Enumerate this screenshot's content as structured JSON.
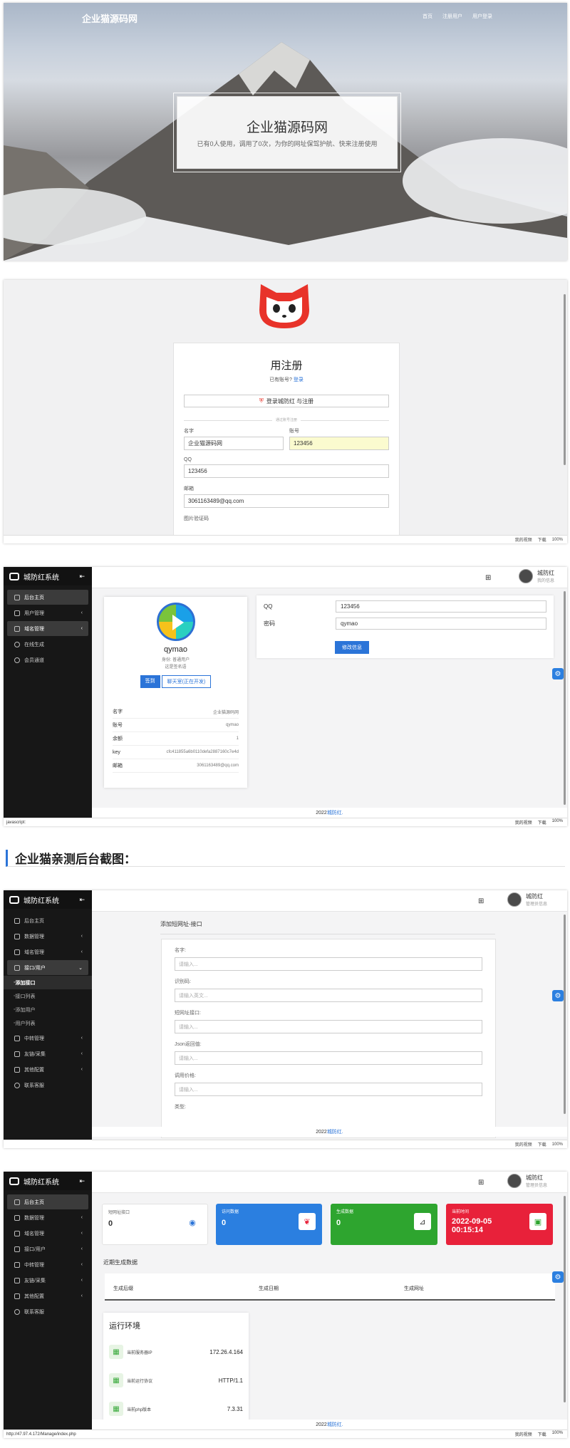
{
  "hero": {
    "title": "企业猫源码网",
    "nav": [
      "首页",
      "注册用户",
      "用户登录"
    ],
    "heading": "企业猫源码网",
    "subtitle": "已有0人使用，调用了0次，为你的网址保驾护航、快来注册使用"
  },
  "register": {
    "heading": "用注册",
    "have_account": "已有账号?",
    "login_link": "登录",
    "qq_button": "登录城防红 与注册",
    "divider": "通过账号注册",
    "fields": {
      "name_label": "名字",
      "name_value": "企业猫源码网",
      "account_label": "账号",
      "account_value": "123456",
      "qq_label": "QQ",
      "qq_value": "123456",
      "email_label": "邮箱",
      "email_value": "3061163489@qq.com",
      "captcha_label": "图片验证码"
    }
  },
  "statusbar": {
    "items": [
      "我的视频",
      "下载",
      "100%"
    ],
    "js": "javascript:",
    "url": "http://47.97.4.172/Manage/index.php"
  },
  "admin1": {
    "brand": "城防红系统",
    "menu": [
      "后台主页",
      "用户管理",
      "域名管理",
      "在线生成",
      "会员通道"
    ],
    "user": {
      "name": "城防红",
      "role": "我的信息"
    },
    "profile": {
      "name": "qymao",
      "role": "身份: 普通用户",
      "note": "这是签名语",
      "btn_sign": "签到",
      "btn_chat": "聊天室(正在开发)",
      "table": [
        {
          "k": "名字",
          "v": "企业猫源码网"
        },
        {
          "k": "账号",
          "v": "qymao"
        },
        {
          "k": "余额",
          "v": "1"
        },
        {
          "k": "key",
          "v": "cfc411855a6b0110defa2887160c7e4d"
        },
        {
          "k": "邮箱",
          "v": "3061163489@qq.com"
        }
      ]
    },
    "form": {
      "qq_label": "QQ",
      "qq_value": "123456",
      "pw_label": "密码",
      "pw_value": "qymao",
      "save": "修改信息"
    },
    "footer_year": "2022 ",
    "footer_link": "城防红."
  },
  "section_heading": "企业猫亲测后台截图：",
  "admin2": {
    "brand": "城防红系统",
    "menu": [
      "后台主页",
      "数据管理",
      "域名管理",
      "接口/用户",
      "中转管理",
      "友链/采集",
      "其他配置",
      "联系客服"
    ],
    "submenu": [
      "添加接口",
      "接口列表",
      "添加用户",
      "用户列表"
    ],
    "user": {
      "name": "城防红",
      "role": "管理员信息"
    },
    "form_title": "添加短网址-接口",
    "fields": [
      {
        "label": "名字:",
        "placeholder": "请输入..."
      },
      {
        "label": "识别码:",
        "placeholder": "请输入英文..."
      },
      {
        "label": "短网址接口:",
        "placeholder": "请输入..."
      },
      {
        "label": "Json返回值:",
        "placeholder": "请输入..."
      },
      {
        "label": "调用价格:",
        "placeholder": "请输入..."
      },
      {
        "label": "类型:",
        "placeholder": ""
      }
    ],
    "footer_year": "2022 ",
    "footer_link": "城防红."
  },
  "admin3": {
    "brand": "城防红系统",
    "menu": [
      "后台主页",
      "数据管理",
      "域名管理",
      "接口/用户",
      "中转管理",
      "友链/采集",
      "其他配置",
      "联系客服"
    ],
    "user": {
      "name": "城防红",
      "role": "管理员信息"
    },
    "stats": [
      {
        "label": "短网址接口",
        "value": "0",
        "color": "#ffffff"
      },
      {
        "label": "访问数据",
        "value": "0",
        "color": "#2b7fe0"
      },
      {
        "label": "生成数据",
        "value": "0",
        "color": "#2ea52f"
      },
      {
        "label": "当前时间",
        "value": "2022-09-05",
        "value2": "00:15:14",
        "color": "#e8213a"
      }
    ],
    "recent": "近期生成数据",
    "table_headers": [
      "生成后缀",
      "生成日期",
      "生成网址"
    ],
    "env_title": "运行环境",
    "env": [
      {
        "k": "当前服务器IP",
        "v": "172.26.4.164"
      },
      {
        "k": "当前运行协议",
        "v": "HTTP/1.1"
      },
      {
        "k": "当前php版本",
        "v": "7.3.31"
      }
    ],
    "footer_year": "2022 ",
    "footer_link": "城防红."
  }
}
